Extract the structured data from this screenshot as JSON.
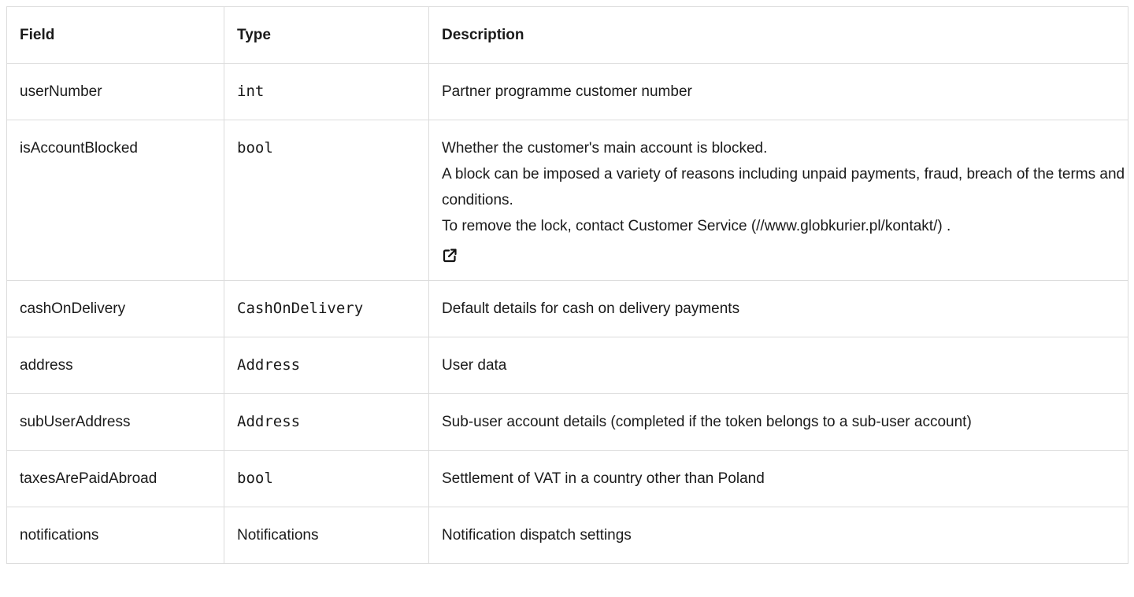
{
  "table": {
    "headers": [
      "Field",
      "Type",
      "Description"
    ],
    "rows": [
      {
        "field": "userNumber",
        "type": "int",
        "type_mono": true,
        "description": [
          "Partner programme customer number"
        ]
      },
      {
        "field": "isAccountBlocked",
        "type": "bool",
        "type_mono": true,
        "description": [
          "Whether the customer's main account is blocked.",
          "A block can be imposed a variety of reasons including unpaid payments, fraud, breach of the terms and conditions.",
          "To remove the lock, contact Customer Service (//www.globkurier.pl/kontakt/) ."
        ],
        "icon": "external-link-icon"
      },
      {
        "field": "cashOnDelivery",
        "type": "CashOnDelivery",
        "type_mono": true,
        "description": [
          "Default details for cash on delivery payments"
        ]
      },
      {
        "field": "address",
        "type": "Address",
        "type_mono": true,
        "description": [
          "User data"
        ]
      },
      {
        "field": "subUserAddress",
        "type": "Address",
        "type_mono": true,
        "description": [
          "Sub-user account details (completed if the token belongs to a sub-user account)"
        ]
      },
      {
        "field": "taxesArePaidAbroad",
        "type": "bool",
        "type_mono": true,
        "description": [
          "Settlement of VAT in a country other than Poland"
        ]
      },
      {
        "field": "notifications",
        "type": "Notifications",
        "type_mono": false,
        "description": [
          "Notification dispatch settings"
        ]
      }
    ]
  }
}
